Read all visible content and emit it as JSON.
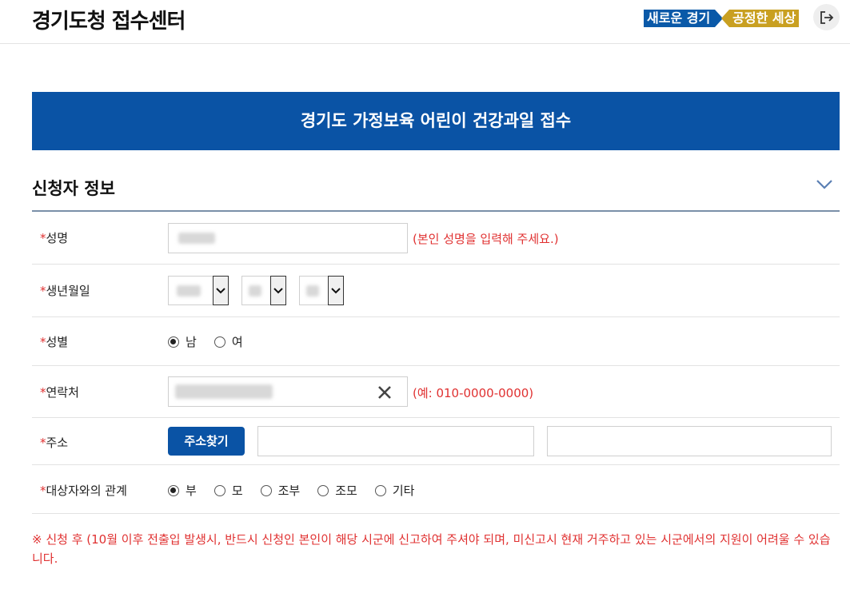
{
  "header": {
    "title": "경기도청 접수센터",
    "slogan_left": "새로운 경기",
    "slogan_right": "공정한 세상",
    "logout_icon": "logout-icon"
  },
  "banner": {
    "title": "경기도 가정보육 어린이 건강과일 접수"
  },
  "section": {
    "title": "신청자 정보",
    "toggle_icon": "chevron-down-icon"
  },
  "form": {
    "required_mark": "*",
    "name": {
      "label": "성명",
      "hint": "(본인 성명을 입력해 주세요.)"
    },
    "birth": {
      "label": "생년월일"
    },
    "gender": {
      "label": "성별",
      "options": [
        "남",
        "여"
      ],
      "selected": "남"
    },
    "phone": {
      "label": "연락처",
      "hint": "(예: 010-0000-0000)",
      "clear_icon": "close-icon"
    },
    "address": {
      "label": "주소",
      "button": "주소찾기"
    },
    "relation": {
      "label": "대상자와의 관계",
      "options": [
        "부",
        "모",
        "조부",
        "조모",
        "기타"
      ],
      "selected": "부"
    }
  },
  "notice": "※ 신청 후 (10월 이후 전출입 발생시, 반드시 신청인 본인이 해당 시군에 신고하여 주셔야 되며, 미신고시 현재 거주하고 있는 시군에서의 지원이 어려울 수 있습니다.",
  "colors": {
    "primary": "#0a53a5",
    "gold": "#c9a021",
    "required": "#e03131"
  }
}
